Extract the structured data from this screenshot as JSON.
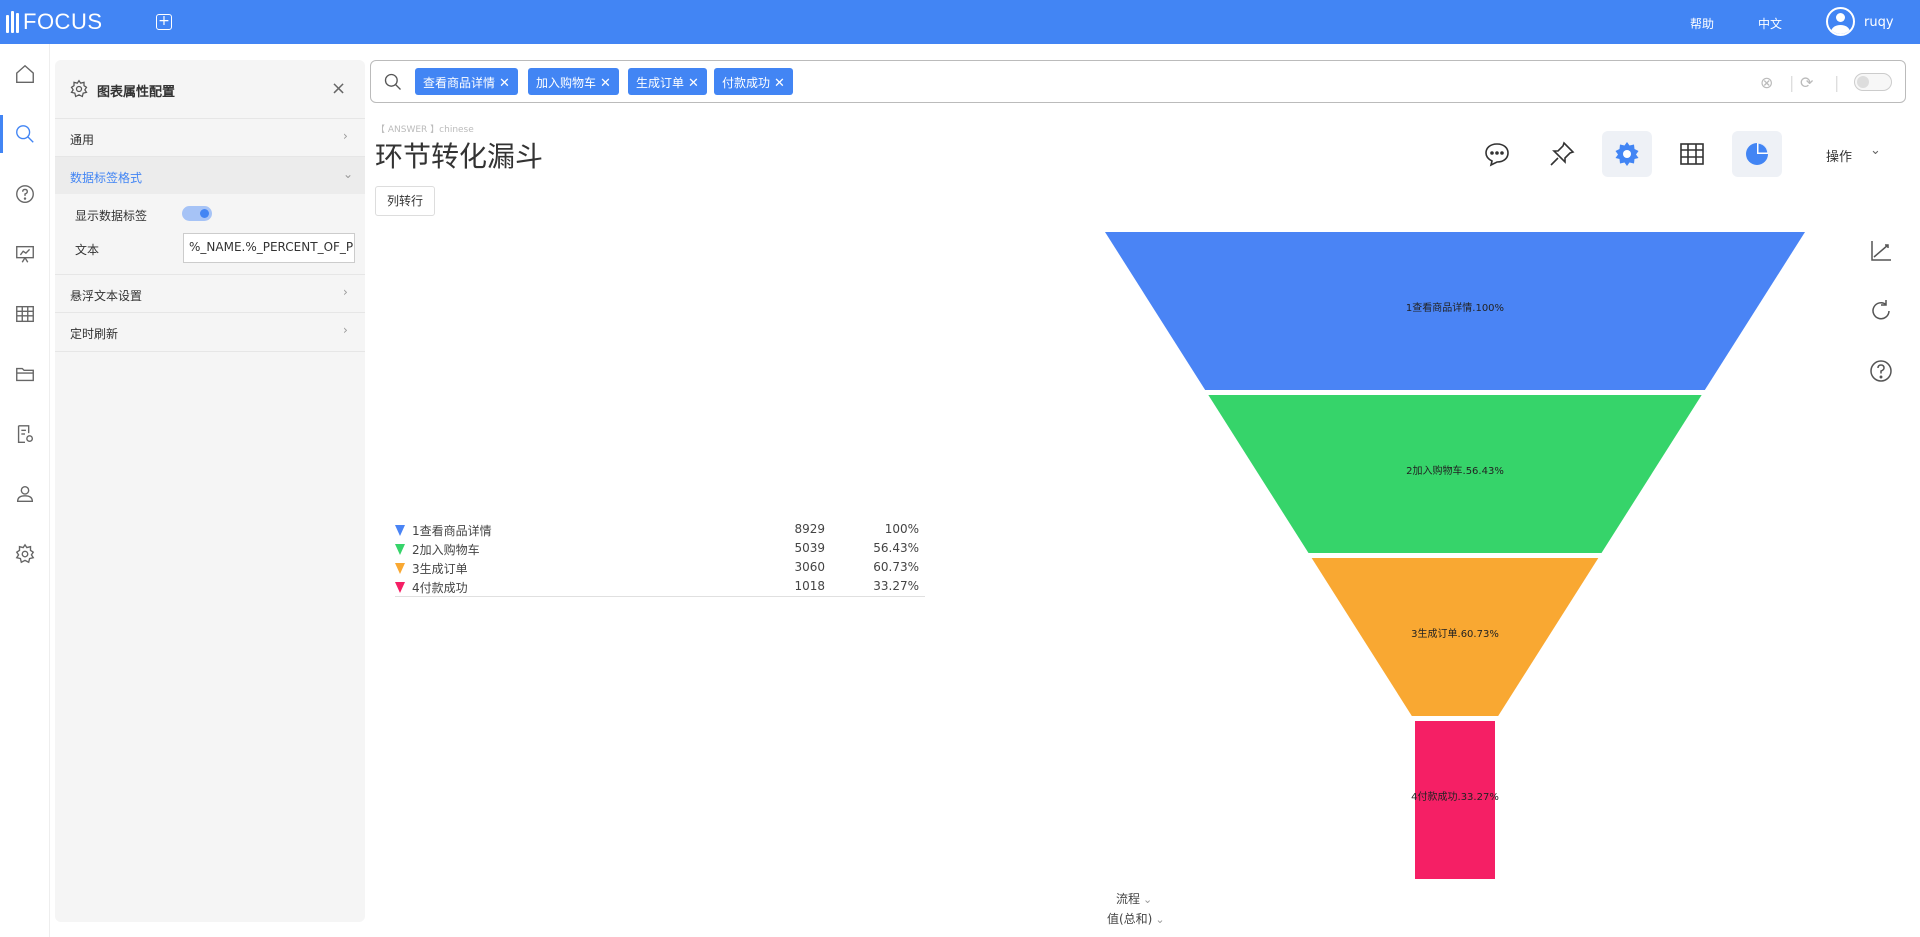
{
  "app": {
    "logo": "FOCUS",
    "help": "帮助",
    "lang": "中文",
    "user": "ruqy"
  },
  "config_panel": {
    "title": "图表属性配置",
    "sections": [
      {
        "label": "通用"
      },
      {
        "label": "数据标签格式"
      },
      {
        "label": "悬浮文本设置"
      },
      {
        "label": "定时刷新"
      }
    ],
    "show_label": "显示数据标签",
    "text_label": "文本",
    "text_value": "%_NAME.%_PERCENT_OF_P"
  },
  "search": {
    "tags": [
      "查看商品详情",
      "加入购物车",
      "生成订单",
      "付款成功"
    ]
  },
  "answer_tag": "【 ANSWER 】chinese",
  "title": "环节转化漏斗",
  "col_to_row": "列转行",
  "toolbar": {
    "ops_label": "操作"
  },
  "colors": {
    "accent": "#4285f4",
    "blue": "#4a84f5",
    "green": "#36d46a",
    "orange": "#f9a832",
    "pink": "#f51f65"
  },
  "chart_data": {
    "type": "funnel",
    "categories": [
      "1查看商品详情",
      "2加入购物车",
      "3生成订单",
      "4付款成功"
    ],
    "values": [
      8929,
      5039,
      3060,
      1018
    ],
    "percents": [
      "100%",
      "56.43%",
      "60.73%",
      "33.27%"
    ],
    "data_labels": [
      "1查看商品详情.100%",
      "2加入购物车.56.43%",
      "3生成订单.60.73%",
      "4付款成功.33.27%"
    ],
    "xlabel": "流程",
    "ylabel": "值(总和)"
  }
}
